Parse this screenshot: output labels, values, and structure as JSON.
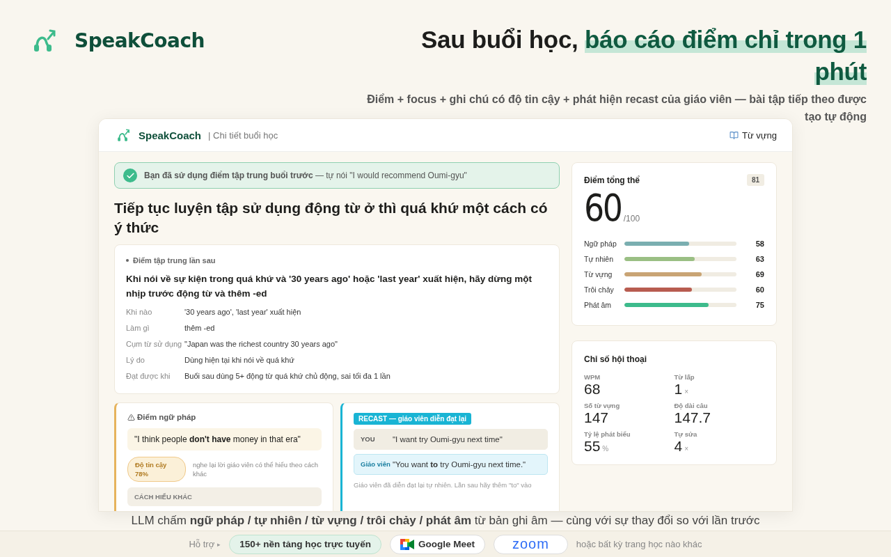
{
  "brand": {
    "name": "SpeakCoach"
  },
  "hero": {
    "headline": "Sau buổi học, ",
    "highlight": "báo cáo điểm chỉ trong 1 phút",
    "subtitle": "Điểm + focus + ghi chú có độ tin cậy + phát hiện recast của giáo viên — bài tập tiếp theo được tạo tự động"
  },
  "app": {
    "brand": "SpeakCoach",
    "page": "| Chi tiết buổi học",
    "nav_link": "Từ vựng",
    "banner": "**Bạn đã sử dụng điểm tập trung buổi trước** — tự nói \"I would recommend Oumi-gyu\"",
    "title": "Tiếp tục luyện tập sử dụng động từ ở thì quá khứ một cách có ý thức",
    "focus": {
      "label": "Điểm tập trung lần sau",
      "text": "Khi nói về sự kiện trong quá khứ và '30 years ago' hoặc 'last year' xuất hiện, hãy dừng một nhịp trước động từ và thêm -ed",
      "details": [
        {
          "label": "Khi nào",
          "value": "'30 years ago', 'last year' xuất hiện"
        },
        {
          "label": "Làm gì",
          "value": "thêm -ed"
        },
        {
          "label": "Cụm từ sử dụng",
          "value": "\"Japan was the richest country 30 years ago\""
        },
        {
          "label": "Lý do",
          "value": "Dùng hiện tại khi nói về quá khứ"
        },
        {
          "label": "Đạt được khi",
          "value": "Buổi sau dùng 5+ động từ quá khứ chủ động, sai tối đa 1 lần"
        }
      ]
    },
    "grammar": {
      "title": "Điểm ngữ pháp",
      "quote": "\"I think people **don't have** money in that era\"",
      "confidence": "Độ tin cậy 78%",
      "note": "nghe lại lời giáo viên có thể hiểu theo cách khác",
      "section": "CÁCH HIỂU KHÁC"
    },
    "recast": {
      "tag": "RECAST — giáo viên diễn đạt lại",
      "rows": [
        {
          "kind": "student",
          "speaker": "YOU",
          "text": "\"I want try Oumi-gyu next time\""
        },
        {
          "kind": "teacher",
          "speaker": "Giáo viên",
          "text": "\"You want **to** try Oumi-gyu next time.\""
        }
      ],
      "note": "Giáo viên đã diễn đạt lại tự nhiên. Lần sau hãy thêm \"to\" vào"
    },
    "score": {
      "title": "Điểm tổng thể",
      "badge": "81",
      "value": "60",
      "max": "/100",
      "items": [
        {
          "label": "Ngữ pháp",
          "value": "58",
          "level": 0.58,
          "color": "#7aaeb0"
        },
        {
          "label": "Tự nhiên",
          "value": "63",
          "level": 0.63,
          "color": "#9abf84"
        },
        {
          "label": "Từ vựng",
          "value": "69",
          "level": 0.69,
          "color": "#c9a474"
        },
        {
          "label": "Trôi chảy",
          "value": "60",
          "level": 0.6,
          "color": "#b85c50"
        },
        {
          "label": "Phát âm",
          "value": "75",
          "level": 0.75,
          "color": "#3dbb8c"
        }
      ]
    },
    "metrics": {
      "title": "Chỉ số hội thoại",
      "items": [
        {
          "label": "WPM",
          "value": "68"
        },
        {
          "label": "Từ lấp",
          "value": "1",
          "unit": "×"
        },
        {
          "label": "Số từ vựng",
          "value": "147"
        },
        {
          "label": "Độ dài câu",
          "value": "147.7"
        },
        {
          "label": "Tỷ lệ phát biểu",
          "value": "55",
          "unit": "%"
        },
        {
          "label": "Tự sửa",
          "value": "4",
          "unit": "×"
        }
      ]
    }
  },
  "caption": "LLM chấm **ngữ pháp / tự nhiên / từ vựng / trôi chảy / phát âm** từ bản ghi âm — cùng với sự thay đổi so với lần trước",
  "footer": {
    "label": "Hỗ trợ",
    "arrow": "▸",
    "platforms": [
      {
        "kind": "text",
        "label": "150+ nền tảng học trực tuyến"
      },
      {
        "kind": "meet",
        "label": "Google Meet"
      },
      {
        "kind": "zoom",
        "label": "zoom"
      }
    ],
    "tail": "hoặc bất kỳ trang học nào khác"
  }
}
